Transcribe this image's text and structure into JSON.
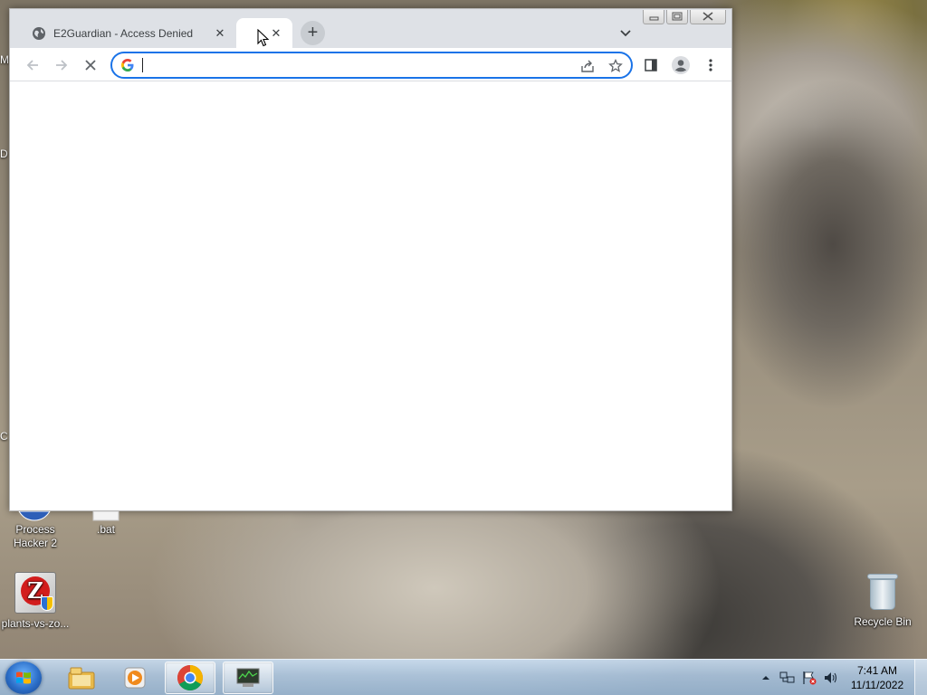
{
  "desktop": {
    "icons": [
      {
        "label": "Process Hacker 2",
        "icon": "process-hacker-icon"
      },
      {
        "label": ".bat",
        "icon": "batch-file-icon"
      },
      {
        "label": "plants-vs-zo...",
        "icon": "plants-vs-zombies-icon"
      },
      {
        "label": "Recycle Bin",
        "icon": "recycle-bin-icon"
      }
    ],
    "edge_letters": [
      "M",
      "D",
      "C"
    ]
  },
  "browser": {
    "tabs": [
      {
        "title": "E2Guardian - Access Denied",
        "favicon": "globe-icon",
        "active": false
      },
      {
        "title": "",
        "favicon": "loading-icon",
        "active": true
      }
    ],
    "window_controls": [
      "minimize",
      "restore",
      "close"
    ],
    "toolbar": {
      "back": "back-arrow-icon",
      "forward": "forward-arrow-icon",
      "stop": "stop-loading-icon",
      "omnibox_value": "",
      "omnibox_icon": "google-g-icon",
      "actions": [
        "share-icon",
        "bookmark-star-icon"
      ],
      "side_panel": "side-panel-icon",
      "profile": "profile-avatar-icon",
      "menu": "kebab-menu-icon"
    }
  },
  "taskbar": {
    "apps": [
      "windows-explorer-icon",
      "media-player-icon",
      "chrome-icon",
      "network-monitor-icon"
    ],
    "tray": [
      "show-hidden-icons",
      "network-icon",
      "action-center-flag-icon",
      "volume-icon"
    ],
    "clock": {
      "time": "7:41 AM",
      "date": "11/11/2022"
    }
  },
  "colors": {
    "accent": "#1a73e8",
    "tabstrip": "#dee1e6"
  }
}
